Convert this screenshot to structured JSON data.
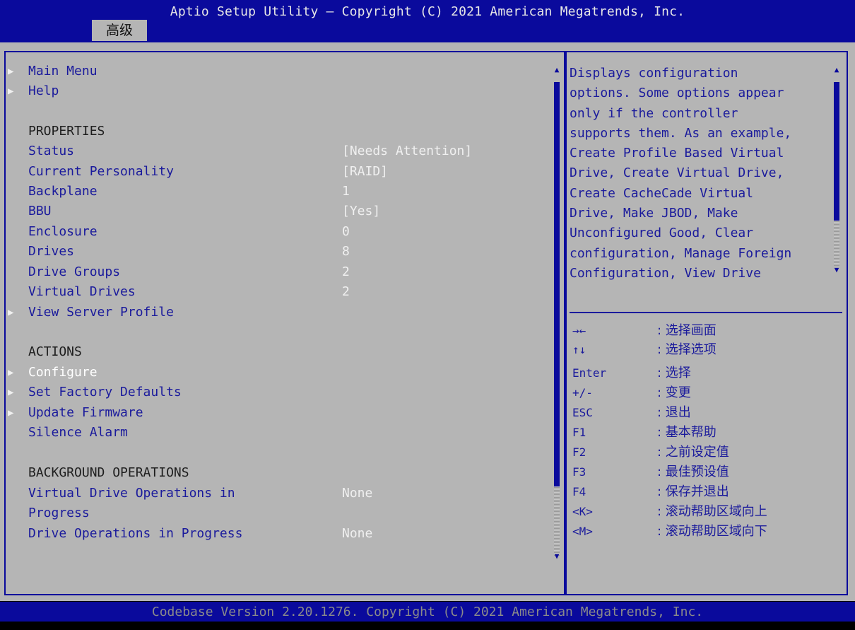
{
  "header": {
    "title": "Aptio Setup Utility – Copyright (C) 2021 American Megatrends, Inc.",
    "tab": "高级"
  },
  "menu": {
    "items": [
      {
        "arrow": "▶",
        "label": "Main Menu"
      },
      {
        "arrow": "▶",
        "label": "Help"
      }
    ],
    "properties_header": "PROPERTIES",
    "properties": [
      {
        "label": "Status",
        "value": "[Needs Attention]"
      },
      {
        "label": "Current Personality",
        "value": "[RAID]"
      },
      {
        "label": "Backplane",
        "value": "1"
      },
      {
        "label": "BBU",
        "value": "[Yes]"
      },
      {
        "label": "Enclosure",
        "value": "0"
      },
      {
        "label": "Drives",
        "value": "8"
      },
      {
        "label": "Drive Groups",
        "value": "2"
      },
      {
        "label": "Virtual Drives",
        "value": "2"
      }
    ],
    "view_server_profile": {
      "arrow": "▶",
      "label": "View Server Profile"
    },
    "actions_header": "ACTIONS",
    "actions": [
      {
        "arrow": "▶",
        "label": "Configure"
      },
      {
        "arrow": "▶",
        "label": "Set Factory Defaults"
      },
      {
        "arrow": "▶",
        "label": "Update Firmware"
      },
      {
        "arrow": "",
        "label": "Silence Alarm"
      }
    ],
    "background_header": "BACKGROUND OPERATIONS",
    "background": {
      "vd_ops_label_1": "Virtual Drive Operations in",
      "vd_ops_label_2": "Progress",
      "vd_ops_value": "None",
      "drive_ops_label": "Drive Operations in Progress",
      "drive_ops_value": "None"
    }
  },
  "help_text": "Displays configuration\noptions. Some options appear\nonly if the controller\nsupports them. As an example,\nCreate Profile Based Virtual\nDrive, Create Virtual Drive,\nCreate CacheCade Virtual\nDrive, Make JBOD, Make\nUnconfigured Good, Clear\nconfiguration, Manage Foreign\nConfiguration, View Drive",
  "keys": [
    {
      "key": "→←",
      "desc": ": 选择画面"
    },
    {
      "key": "↑↓",
      "desc": ": 选择选项"
    },
    {
      "key": "Enter",
      "desc": ": 选择"
    },
    {
      "key": "+/-",
      "desc": ": 变更"
    },
    {
      "key": "ESC",
      "desc": ": 退出"
    },
    {
      "key": "F1",
      "desc": ": 基本帮助"
    },
    {
      "key": "F2",
      "desc": ": 之前设定值"
    },
    {
      "key": "F3",
      "desc": ": 最佳预设值"
    },
    {
      "key": "F4",
      "desc": ": 保存并退出"
    },
    {
      "key": "<K>",
      "desc": ": 滚动帮助区域向上"
    },
    {
      "key": "<M>",
      "desc": ": 滚动帮助区域向下"
    }
  ],
  "footer": "Codebase Version 2.20.1276. Copyright (C) 2021 American Megatrends, Inc.",
  "colors": {
    "bios_blue": "#0a0a9c",
    "panel_gray": "#b5b5b5",
    "text_blue": "#1a1a9c"
  }
}
